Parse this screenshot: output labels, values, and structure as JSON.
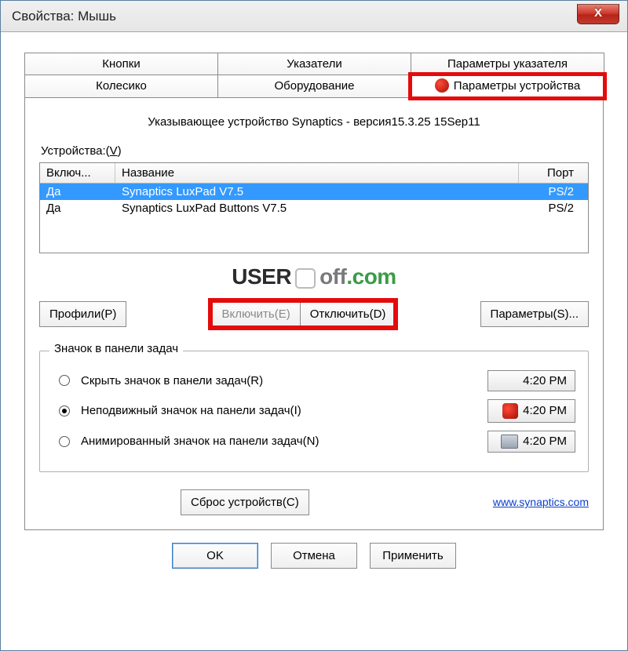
{
  "window": {
    "title": "Свойства: Мышь",
    "close_label": "X"
  },
  "tabs": {
    "row1": [
      "Кнопки",
      "Указатели",
      "Параметры указателя"
    ],
    "row2": [
      "Колесико",
      "Оборудование",
      "Параметры устройства"
    ]
  },
  "main": {
    "info_line": "Указывающее устройство Synaptics - версия15.3.25 15Sep11",
    "devices_label_prefix": "Устройства:(",
    "devices_label_key": "V",
    "devices_label_suffix": ")"
  },
  "table": {
    "headers": {
      "enabled": "Включ...",
      "name": "Название",
      "port": "Порт"
    },
    "rows": [
      {
        "enabled": "Да",
        "name": "Synaptics LuxPad V7.5",
        "port": "PS/2",
        "selected": true
      },
      {
        "enabled": "Да",
        "name": "Synaptics LuxPad Buttons V7.5",
        "port": "PS/2",
        "selected": false
      }
    ]
  },
  "watermark": {
    "user": "USER",
    "off": "off",
    "com": ".com"
  },
  "buttons": {
    "profiles": "Профили(P)",
    "enable": "Включить(E)",
    "disable": "Отключить(D)",
    "params": "Параметры(S)..."
  },
  "tray": {
    "legend": "Значок в панели задач",
    "option_hide": "Скрыть значок в панели задач(R)",
    "option_static": "Неподвижный значок на панели задач(I)",
    "option_animated": "Анимированный значок на панели задач(N)",
    "time": "4:20 PM"
  },
  "reset": {
    "button": "Сброс устройств(C)",
    "link": "www.synaptics.com"
  },
  "footer": {
    "ok": "OK",
    "cancel": "Отмена",
    "apply": "Применить"
  }
}
